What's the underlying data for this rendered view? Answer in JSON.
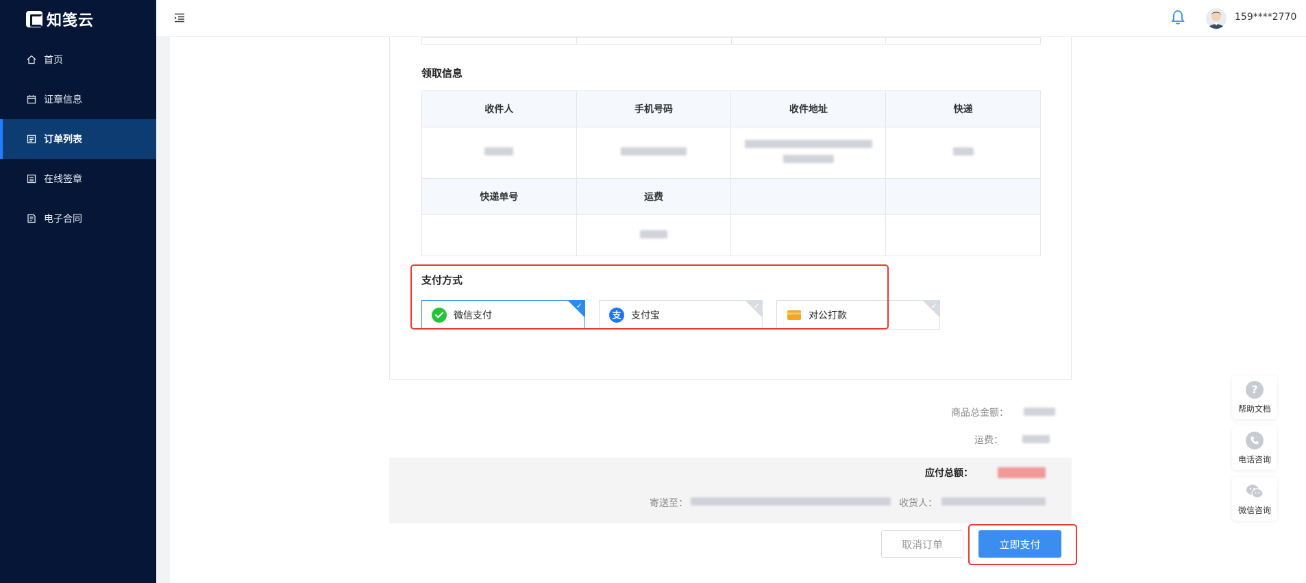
{
  "app": {
    "logo_text": "知笺云"
  },
  "sidebar": {
    "items": [
      {
        "label": "首页",
        "icon": "home-icon"
      },
      {
        "label": "证章信息",
        "icon": "calendar-icon"
      },
      {
        "label": "订单列表",
        "icon": "list-icon",
        "active": true
      },
      {
        "label": "在线签章",
        "icon": "document-icon"
      },
      {
        "label": "电子合同",
        "icon": "contract-icon"
      }
    ]
  },
  "header": {
    "user_name": "159****2770"
  },
  "receive_info": {
    "title": "领取信息",
    "headers_row1": [
      "收件人",
      "手机号码",
      "收件地址",
      "快递"
    ],
    "headers_row2": [
      "快递单号",
      "运费",
      "",
      ""
    ]
  },
  "payment": {
    "title": "支付方式",
    "options": [
      {
        "label": "微信支付",
        "icon": "wechat-pay-icon",
        "selected": true
      },
      {
        "label": "支付宝",
        "icon": "alipay-icon",
        "selected": false
      },
      {
        "label": "对公打款",
        "icon": "bank-card-icon",
        "selected": false
      }
    ]
  },
  "summary": {
    "goods_total_label": "商品总金额：",
    "shipping_label": "运费：",
    "payable_label": "应付总额：",
    "ship_to_label": "寄送至：",
    "receiver_label": "收货人："
  },
  "actions": {
    "cancel_label": "取消订单",
    "pay_label": "立即支付"
  },
  "float_help": [
    {
      "label": "帮助文档",
      "icon": "question-icon"
    },
    {
      "label": "电话咨询",
      "icon": "phone-icon"
    },
    {
      "label": "微信咨询",
      "icon": "wechat-icon"
    }
  ],
  "colors": {
    "sidebar_bg": "#051637",
    "accent": "#3a8ef0",
    "highlight_border": "#e8382f"
  }
}
